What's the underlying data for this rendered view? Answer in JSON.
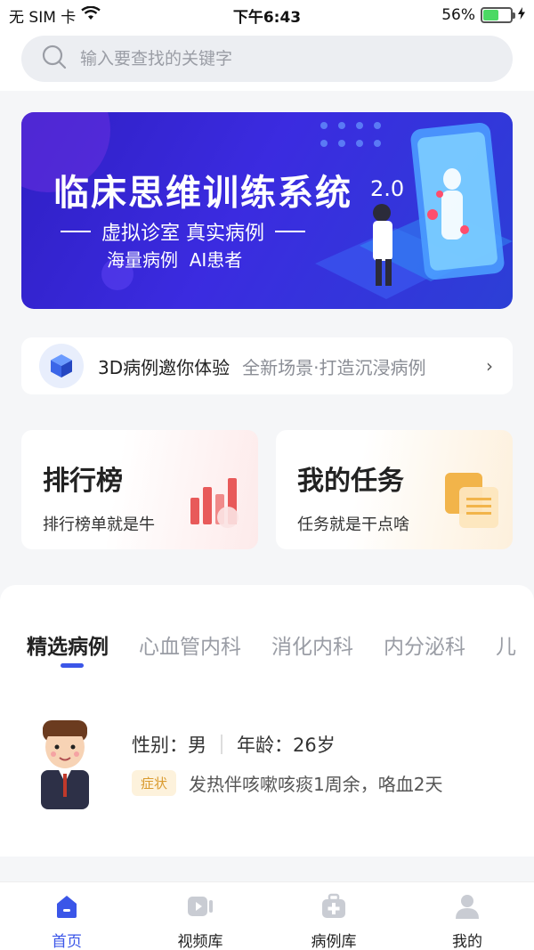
{
  "status_bar": {
    "carrier": "无 SIM 卡",
    "time": "下午6:43",
    "battery_percent": "56%",
    "battery_level": 0.56,
    "icons": [
      "wifi-icon",
      "battery-icon",
      "charging-icon"
    ]
  },
  "search": {
    "placeholder": "输入要查找的关键字"
  },
  "banner": {
    "title": "临床思维训练系统",
    "version": "2.0",
    "subtitle": "虚拟诊室 真实病例",
    "tags": "海量病例  AI患者"
  },
  "promo_strip": {
    "title": "3D病例邀你体验",
    "description": "全新场景·打造沉浸病例",
    "arrow": "›"
  },
  "cards": {
    "ranking": {
      "title": "排行榜",
      "subtitle": "排行榜单就是牛"
    },
    "tasks": {
      "title": "我的任务",
      "subtitle": "任务就是干点啥"
    }
  },
  "feed": {
    "tabs": [
      {
        "label": "精选病例",
        "active": true
      },
      {
        "label": "心血管内科",
        "active": false
      },
      {
        "label": "消化内科",
        "active": false
      },
      {
        "label": "内分泌科",
        "active": false
      },
      {
        "label": "儿",
        "active": false
      }
    ],
    "case": {
      "gender_label": "性别：",
      "gender": "男",
      "age_label": "年龄：",
      "age": "26岁",
      "badge": "症状",
      "symptom": "发热伴咳嗽咳痰1周余，咯血2天"
    }
  },
  "tabbar": {
    "items": [
      {
        "label": "首页",
        "icon": "home-icon",
        "active": true
      },
      {
        "label": "视频库",
        "icon": "video-icon",
        "active": false
      },
      {
        "label": "病例库",
        "icon": "medical-kit-icon",
        "active": false
      },
      {
        "label": "我的",
        "icon": "user-icon",
        "active": false
      }
    ]
  },
  "colors": {
    "accent": "#3b56e8",
    "badge_text": "#d99a2e",
    "banner_bg": "#3b2be0"
  }
}
